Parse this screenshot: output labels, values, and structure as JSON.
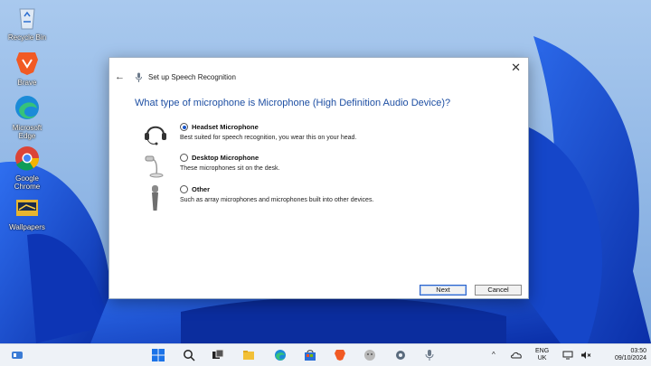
{
  "desktop": {
    "icons": [
      {
        "label": "Recycle Bin"
      },
      {
        "label": "Brave"
      },
      {
        "label": "Microsoft Edge"
      },
      {
        "label": "Google Chrome"
      },
      {
        "label": "Wallpapers"
      }
    ]
  },
  "dialog": {
    "close_glyph": "✕",
    "back_glyph": "←",
    "title": "Set up Speech Recognition",
    "question": "What type of microphone is Microphone (High Definition Audio Device)?",
    "options": [
      {
        "name": "Headset Microphone",
        "desc": "Best suited for speech recognition, you wear this on your head.",
        "selected": true
      },
      {
        "name": "Desktop Microphone",
        "desc": "These microphones sit on the desk.",
        "selected": false
      },
      {
        "name": "Other",
        "desc": "Such as array microphones and microphones built into other devices.",
        "selected": false
      }
    ],
    "next_label": "Next",
    "cancel_label": "Cancel"
  },
  "taskbar": {
    "tray": {
      "chevron": "^",
      "lang_line1": "ENG",
      "lang_line2": "UK",
      "time": "03:50",
      "date": "09/10/2024"
    }
  },
  "colors": {
    "accent": "#1a56c8",
    "question_text": "#1e4fa3",
    "wallpaper_base": "#8fb7e6"
  }
}
